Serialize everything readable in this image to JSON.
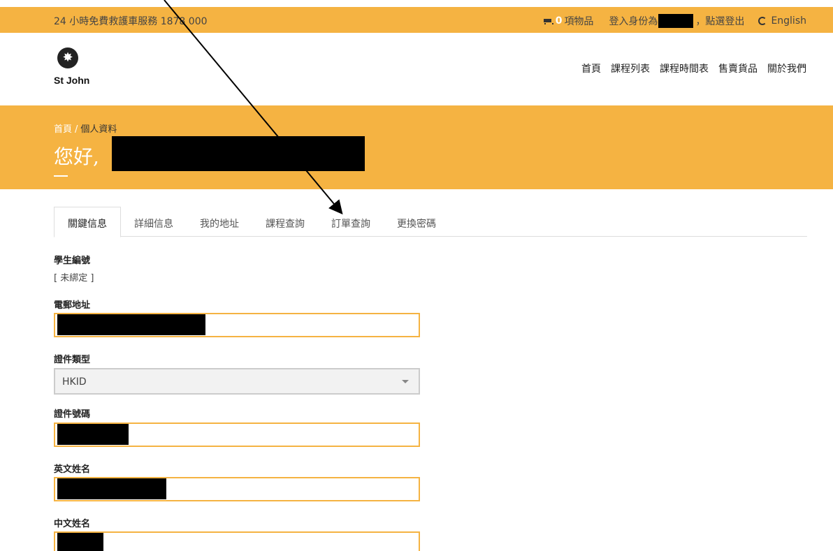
{
  "topbar": {
    "hotline": "24 小時免費救護車服務 1878 000",
    "cart_count": "0",
    "cart_label": "項物品",
    "login_prefix": "登入身份為",
    "logout": "，點選登出",
    "language": "English"
  },
  "header": {
    "logo_text": "St John",
    "nav": [
      "首頁",
      "課程列表",
      "課程時間表",
      "售賣貨品",
      "關於我們"
    ]
  },
  "hero": {
    "breadcrumb_home": "首頁",
    "breadcrumb_sep": "/",
    "breadcrumb_current": "個人資料",
    "greeting": "您好,"
  },
  "tabs": [
    "關鍵信息",
    "詳細信息",
    "我的地址",
    "課程查詢",
    "訂單查詢",
    "更換密碼"
  ],
  "form": {
    "student_id_label": "學生編號",
    "student_id_value": "[ 未綁定 ]",
    "email_label": "電郵地址",
    "id_type_label": "證件類型",
    "id_type_value": "HKID",
    "id_number_label": "證件號碼",
    "english_name_label": "英文姓名",
    "chinese_name_label": "中文姓名"
  },
  "colors": {
    "accent": "#f5b342",
    "redaction": "#000000"
  }
}
